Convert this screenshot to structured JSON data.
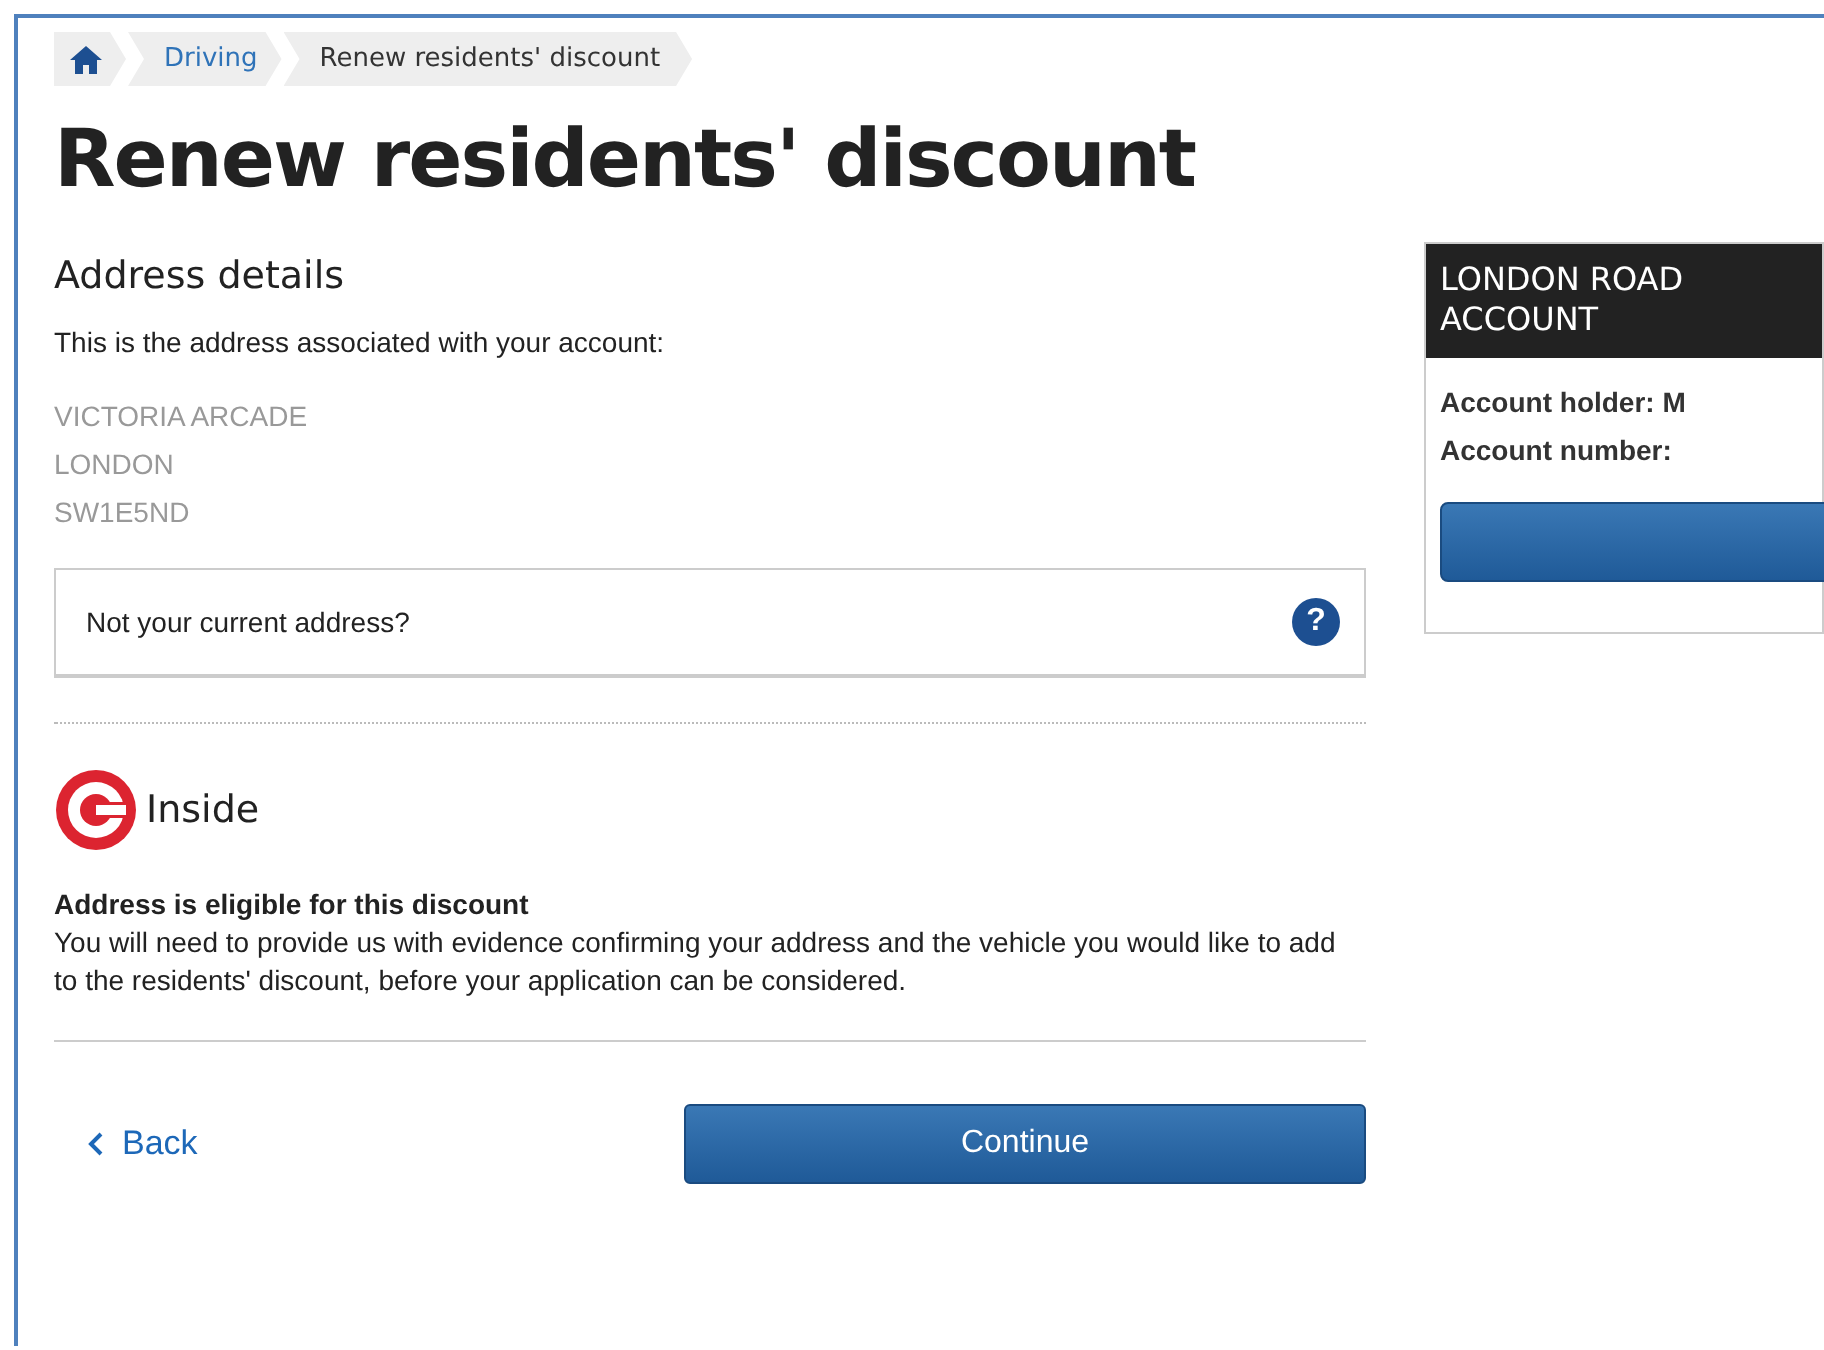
{
  "breadcrumb": [
    {
      "kind": "home"
    },
    {
      "kind": "link",
      "label": "Driving"
    },
    {
      "kind": "current",
      "label": "Renew residents' discount"
    }
  ],
  "title": "Renew residents' discount",
  "address_section": {
    "heading": "Address details",
    "intro": "This is the address associated with your account:",
    "lines": [
      "VICTORIA ARCADE",
      "LONDON",
      "SW1E5ND"
    ],
    "help_row": "Not your current address?",
    "help_icon": "?"
  },
  "zone": {
    "label": "Inside",
    "eligibility_title": "Address is eligible for this discount",
    "eligibility_text": "You will need to provide us with evidence confirming your address and the vehicle you would like to add to the residents' discount, before your application can be considered."
  },
  "actions": {
    "back": "Back",
    "continue": "Continue"
  },
  "account_panel": {
    "title_lines": [
      "LONDON ROAD",
      "ACCOUNT"
    ],
    "holder": "Account holder: M",
    "number": "Account number:"
  }
}
